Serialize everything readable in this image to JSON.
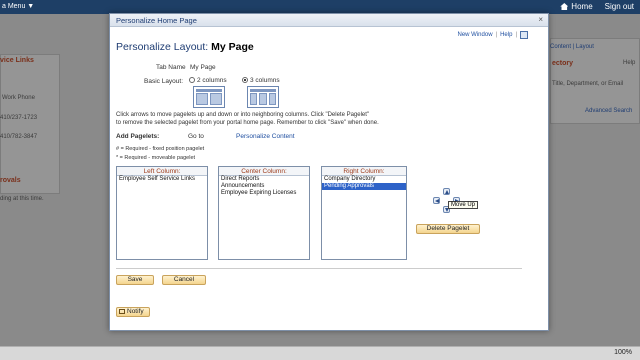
{
  "topbar": {
    "menu_label": "a Menu ▼",
    "home_label": "Home",
    "signout_label": "Sign out"
  },
  "background": {
    "left_section1": "vice Links",
    "work_phone": "Work Phone",
    "phone1": "410/237-1723",
    "phone2": "410/782-3847",
    "left_section2": "rovals",
    "approvals_text": "ding at this time.",
    "right_header_links": "Content | Layout",
    "right_section": "ectory",
    "directory_hint": "Title, Department, or Email",
    "advanced_search": "Advanced Search",
    "help_label": "Help"
  },
  "modal": {
    "title": "Personalize Home Page",
    "close_label": "×",
    "new_window": "New Window",
    "help": "Help",
    "heading_prefix": "Personalize Layout:",
    "heading_name": "My Page",
    "tab_name_label": "Tab Name",
    "tab_name_value": "My Page",
    "basic_layout_label": "Basic Layout:",
    "two_columns": "2 columns",
    "three_columns": "3 columns",
    "selected_layout": "3 columns",
    "instructions_line1": "Click arrows to move pagelets up and down or into neighboring columns. Click \"Delete Pagelet\"",
    "instructions_line2": "to remove the selected pagelet from your portal home page. Remember to click \"Save\" when done.",
    "add_pagelets_label": "Add Pagelets:",
    "go_to": "Go to",
    "personalize_content": "Personalize Content",
    "legend_fixed": "# = Required - fixed position pagelet",
    "legend_moveable": "* = Required - moveable pagelet",
    "columns": [
      {
        "header": "Left Column:",
        "items": [
          "Employee Self Service Links"
        ]
      },
      {
        "header": "Center Column:",
        "items": [
          "Direct Reports",
          "Announcements",
          "Employee Expiring Licenses"
        ]
      },
      {
        "header": "Right Column:",
        "items": [
          "Company Directory",
          "Pending Approvals"
        ]
      }
    ],
    "selected_item": "Pending Approvals",
    "tooltip": "Move Up",
    "delete_pagelet": "Delete Pagelet",
    "save": "Save",
    "cancel": "Cancel",
    "notify": "Notify"
  },
  "statusbar": {
    "zoom": "100%"
  }
}
